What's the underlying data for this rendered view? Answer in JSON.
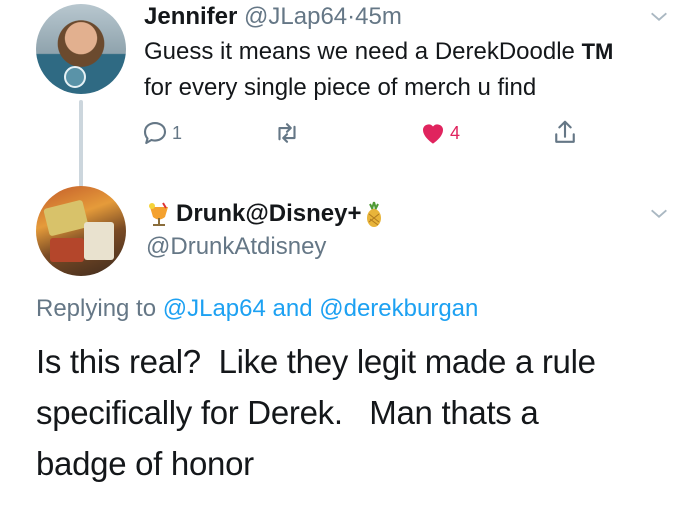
{
  "tweet1": {
    "name": "Jennifer",
    "handle": "@JLap64",
    "separator": "·",
    "time": "45m",
    "text": "Guess it means we need a DerekDoodle",
    "tm": "TM",
    "text2": "for every single piece of merch u find",
    "reply_count": "1",
    "like_count": "4",
    "icons": {
      "reply": "reply-icon",
      "retweet": "retweet-icon",
      "like": "heart-icon",
      "share": "share-icon",
      "more": "chevron-down-icon"
    },
    "colors": {
      "like": "#e0245e",
      "muted": "#657786",
      "link": "#1da1f2"
    }
  },
  "tweet2": {
    "name": "Drunk@Disney+",
    "handle": "@DrunkAtdisney",
    "replying_prefix": "Replying to",
    "replying_user1": "@JLap64",
    "replying_and": "and",
    "replying_user2": "@derekburgan",
    "body_line1": "Is this real?  Like they legit made a rule",
    "body_line2": "specifically for Derek.   Man thats a",
    "body_line3": "badge of honor",
    "icons": {
      "cocktail": "tropical-drink-icon",
      "pineapple": "pineapple-icon"
    }
  }
}
